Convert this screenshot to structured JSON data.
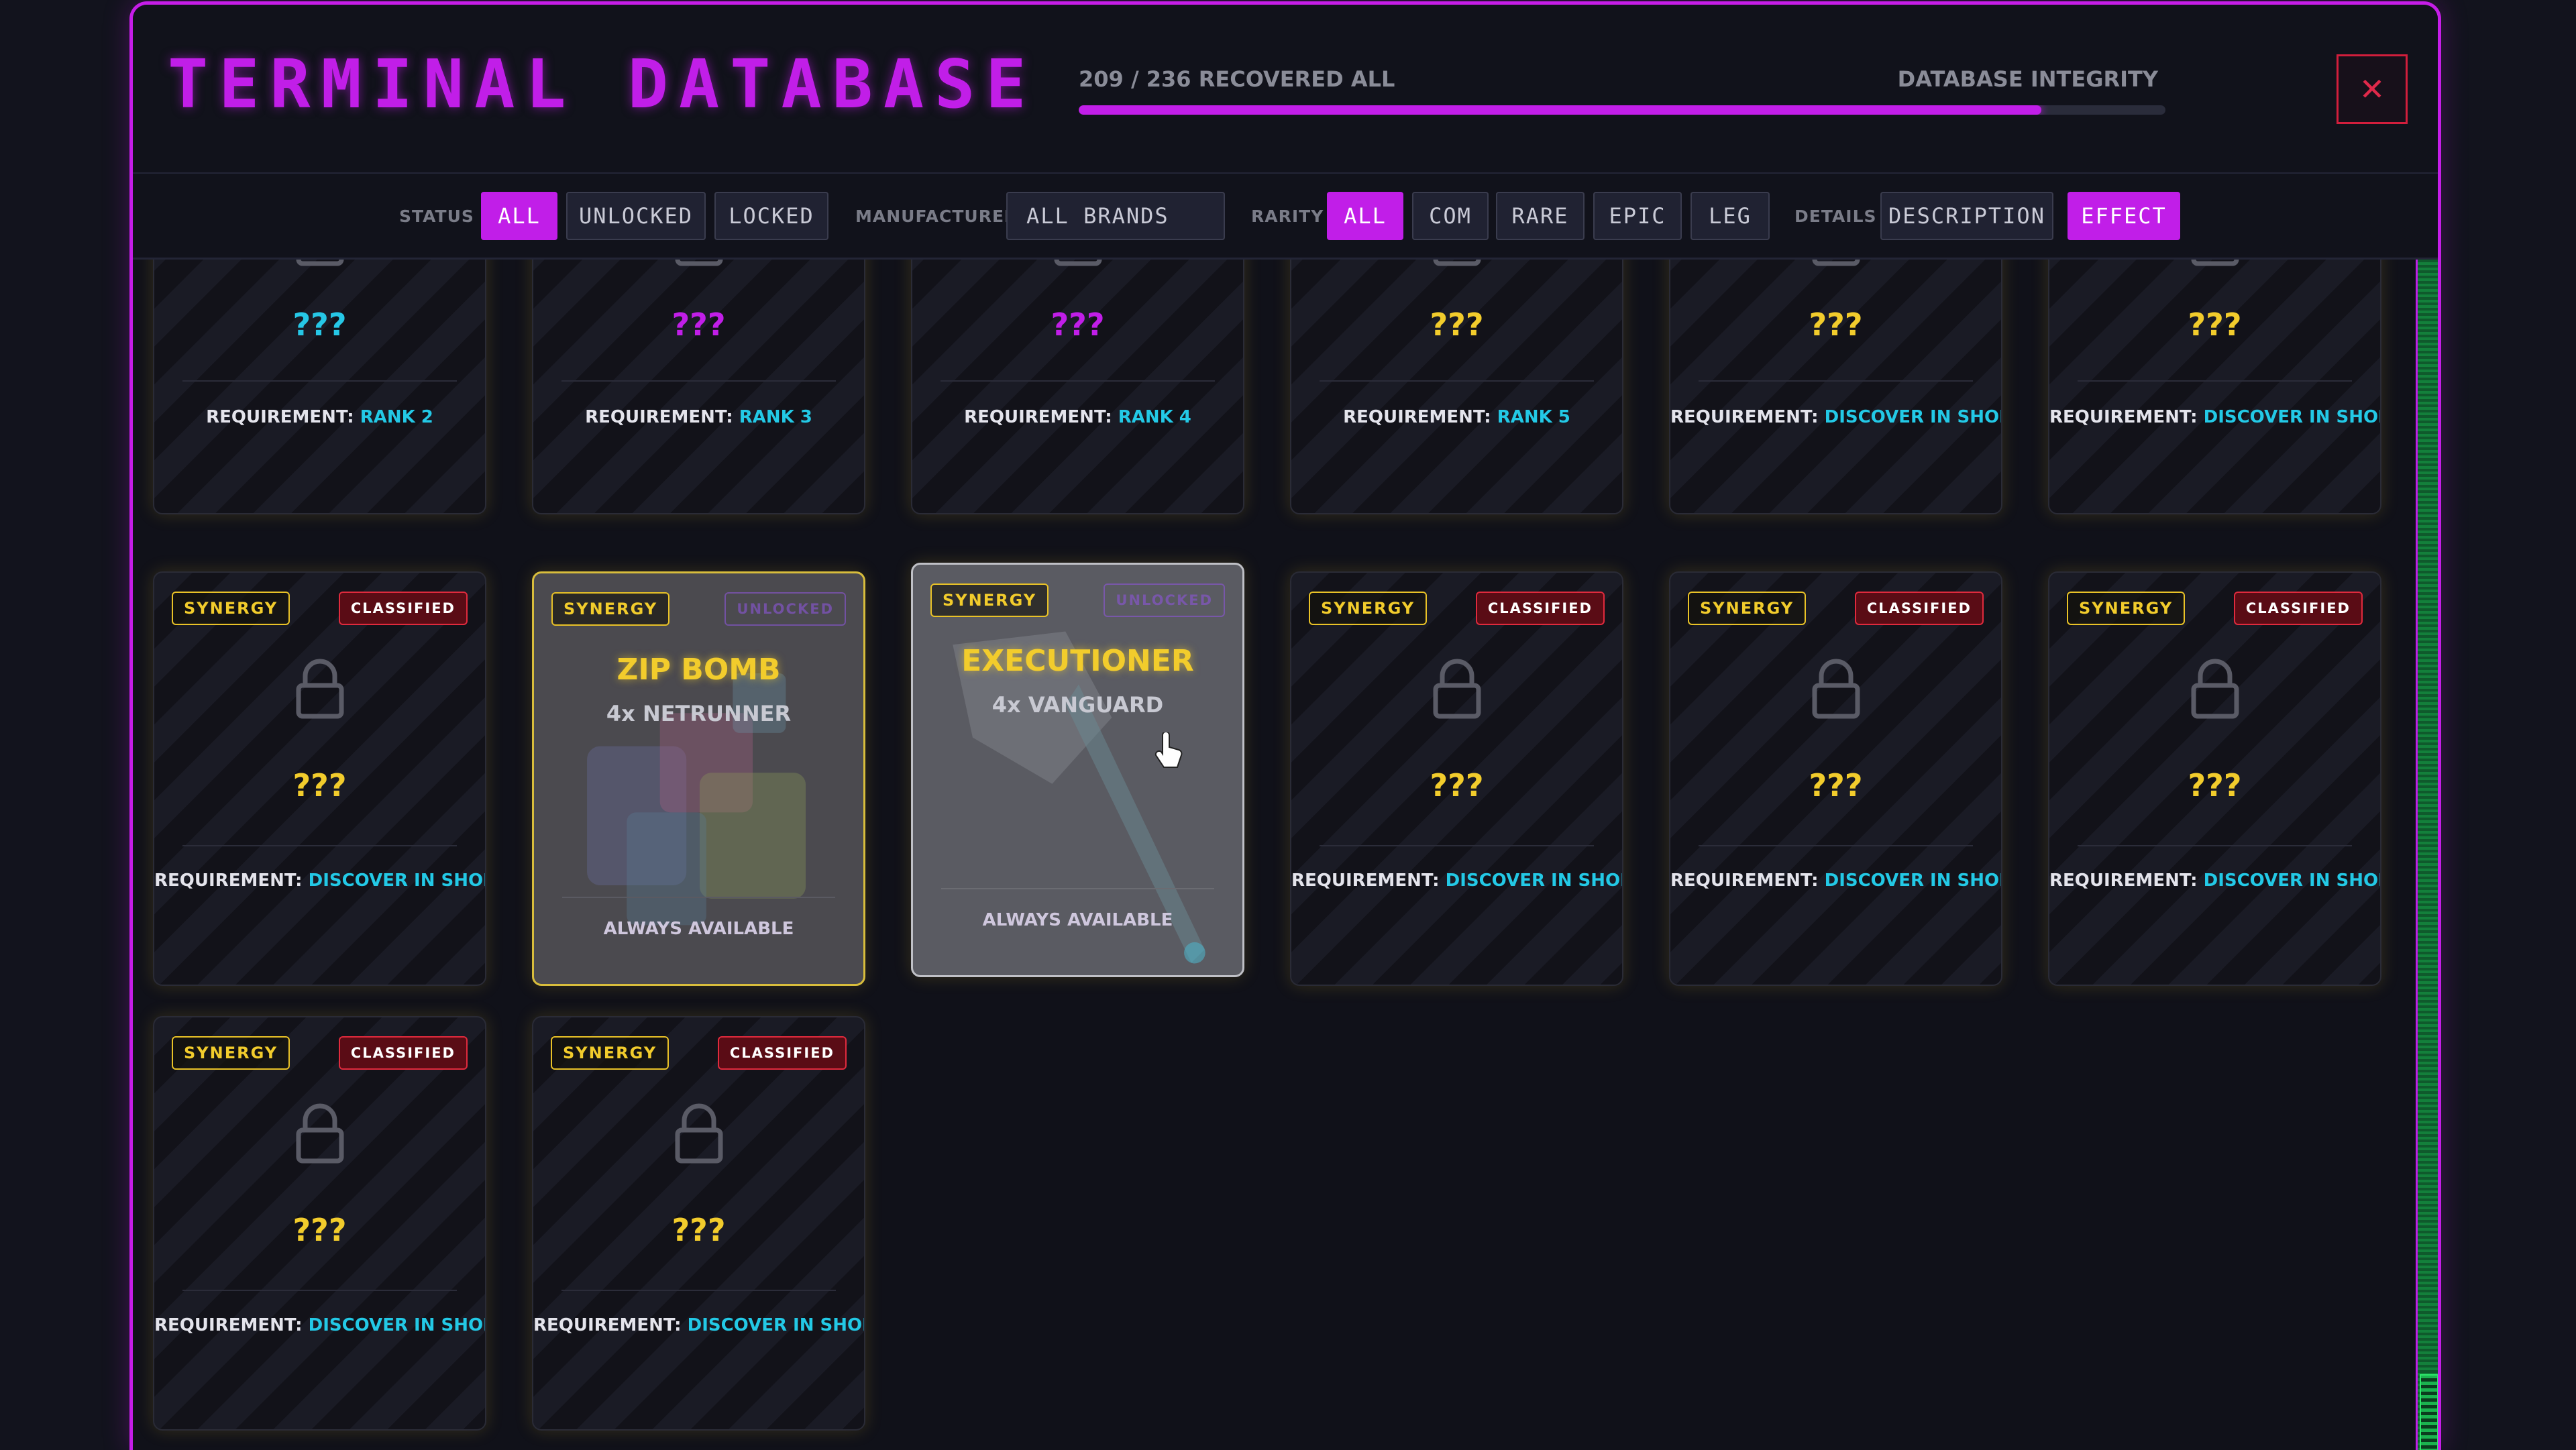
{
  "header": {
    "title": "TERMINAL DATABASE",
    "progress_text": "209 / 236 RECOVERED ALL",
    "integrity_label": "DATABASE INTEGRITY",
    "progress_fraction": 0.8856,
    "close_symbol": "✕"
  },
  "filters": {
    "status_label": "STATUS",
    "status_options": [
      "ALL",
      "UNLOCKED",
      "LOCKED"
    ],
    "status_selected": "ALL",
    "manufacturer_label": "MANUFACTURER",
    "manufacturer_value": "ALL BRANDS",
    "rarity_label": "RARITY",
    "rarity_options": [
      "ALL",
      "COM",
      "RARE",
      "EPIC",
      "LEG"
    ],
    "rarity_selected": "ALL",
    "details_label": "DETAILS",
    "details_options": [
      "DESCRIPTION",
      "EFFECT"
    ],
    "details_selected": "EFFECT"
  },
  "common": {
    "unknown": "???",
    "requirement_prefix": "REQUIREMENT: ",
    "synergy_tag": "SYNERGY",
    "classified_tag": "CLASSIFIED",
    "unlocked_tag": "UNLOCKED",
    "always_available": "ALWAYS AVAILABLE"
  },
  "cards_row1": [
    {
      "requirement": "RANK 2",
      "color": "cyan"
    },
    {
      "requirement": "RANK 3",
      "color": "purple"
    },
    {
      "requirement": "RANK 4",
      "color": "purple"
    },
    {
      "requirement": "RANK 5",
      "color": "yellow"
    },
    {
      "requirement": "DISCOVER IN SHOP",
      "color": "yellow"
    },
    {
      "requirement": "DISCOVER IN SHOP",
      "color": "yellow"
    }
  ],
  "cards_row2": [
    {
      "requirement": "DISCOVER IN SHOP"
    },
    {
      "name": "ZIP BOMB",
      "sub": "4x NETRUNNER"
    },
    {
      "name": "EXECUTIONER",
      "sub": "4x VANGUARD"
    },
    {
      "requirement": "DISCOVER IN SHOP"
    },
    {
      "requirement": "DISCOVER IN SHOP"
    },
    {
      "requirement": "DISCOVER IN SHOP"
    }
  ],
  "cards_row3": [
    {
      "requirement": "DISCOVER IN SHOP"
    },
    {
      "requirement": "DISCOVER IN SHOP"
    }
  ],
  "colors": {
    "accent": "#c11ee8",
    "gold": "#f2cc2c",
    "cyan": "#23c9e6",
    "danger": "#e02a3d"
  },
  "icons": [
    "lock-icon",
    "close-icon",
    "hand-cursor-icon",
    "cube-art-icon",
    "axe-art-icon"
  ]
}
